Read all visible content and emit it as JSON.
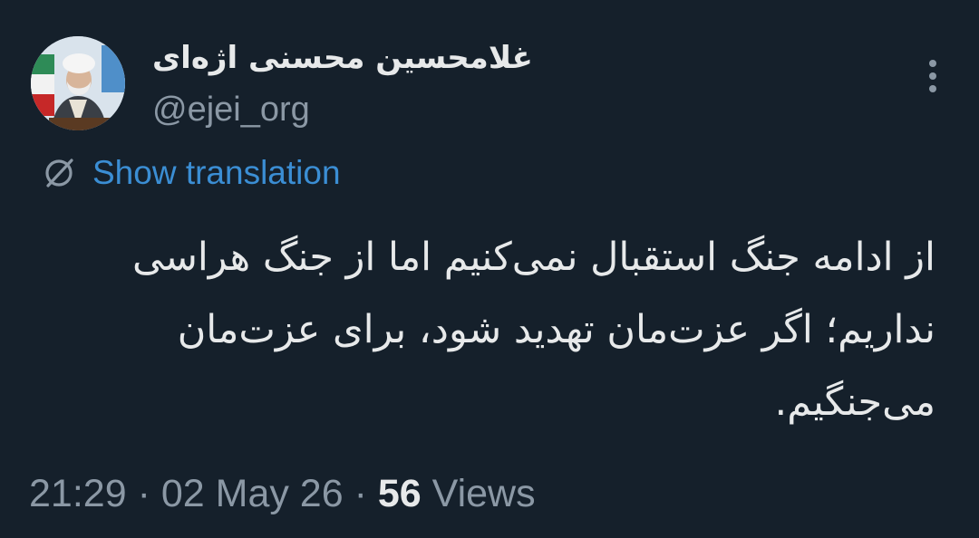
{
  "author": {
    "display_name": "غلامحسین محسنی اژه‌ای",
    "handle": "@ejei_org"
  },
  "actions": {
    "more_icon": "more-vertical-icon",
    "translate_icon": "globe-translate-icon",
    "translate_label": "Show translation"
  },
  "tweet": {
    "text": "از ادامه جنگ استقبال نمی‌کنیم اما از جنگ هراسی نداریم؛ اگر عزت‌مان تهدید شود، برای عزت‌مان می‌جنگیم."
  },
  "meta": {
    "time": "21:29",
    "separator": "·",
    "date": "02 May 26",
    "views_count": "56",
    "views_label": "Views"
  },
  "colors": {
    "background": "#15202b",
    "primary_text": "#e7e9ea",
    "secondary_text": "#8b98a5",
    "link": "#3b8ed4"
  }
}
